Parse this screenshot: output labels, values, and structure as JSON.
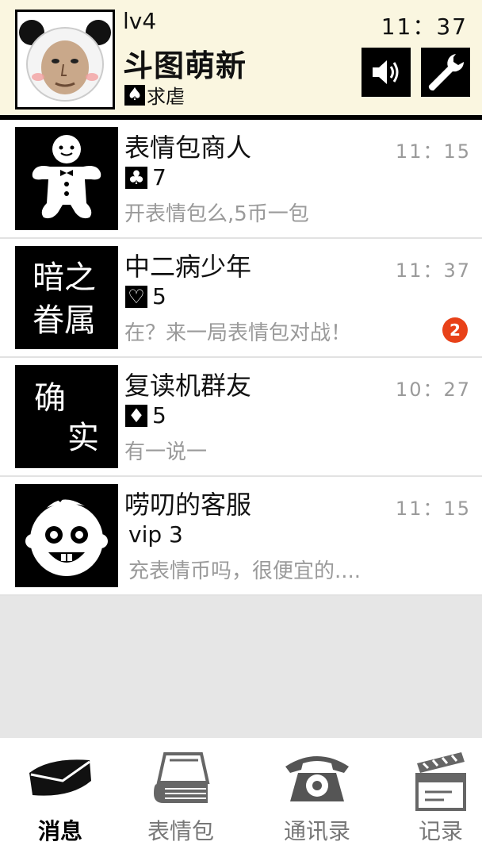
{
  "header": {
    "level": "lv4",
    "name": "斗图萌新",
    "status_suit": "♠",
    "status_text": "求虐",
    "time": "11：37",
    "sound_icon": "speaker-icon",
    "settings_icon": "wrench-icon"
  },
  "conversations": [
    {
      "name": "表情包商人",
      "suit": "♣",
      "level": "7",
      "message": "开表情包么,5币一包",
      "time": "11：15",
      "avatar": "gingerbread-icon"
    },
    {
      "name": "中二病少年",
      "suit": "♡",
      "level": "5",
      "message": "在？来一局表情包对战！",
      "time": "11：37",
      "badge": "2",
      "avatar_lines": [
        "暗之",
        "眷属"
      ]
    },
    {
      "name": "复读机群友",
      "suit": "♦",
      "level": "5",
      "message": "有一说一",
      "time": "10：27",
      "avatar_lines": [
        "确",
        "实"
      ]
    },
    {
      "name": "唠叨的客服",
      "vip": "vip 3",
      "message": "充表情币吗，很便宜的....",
      "time": "11：15",
      "avatar": "baby-face-icon"
    }
  ],
  "nav": {
    "tabs": [
      {
        "label": "消息",
        "icon": "envelope-icon",
        "active": true
      },
      {
        "label": "表情包",
        "icon": "book-stack-icon",
        "active": false
      },
      {
        "label": "通讯录",
        "icon": "telephone-icon",
        "active": false
      },
      {
        "label": "记录",
        "icon": "clapperboard-icon",
        "active": false
      }
    ]
  },
  "colors": {
    "badge": "#e84118",
    "header_bg": "#faf6e0",
    "muted_text": "#9a9a9a"
  }
}
